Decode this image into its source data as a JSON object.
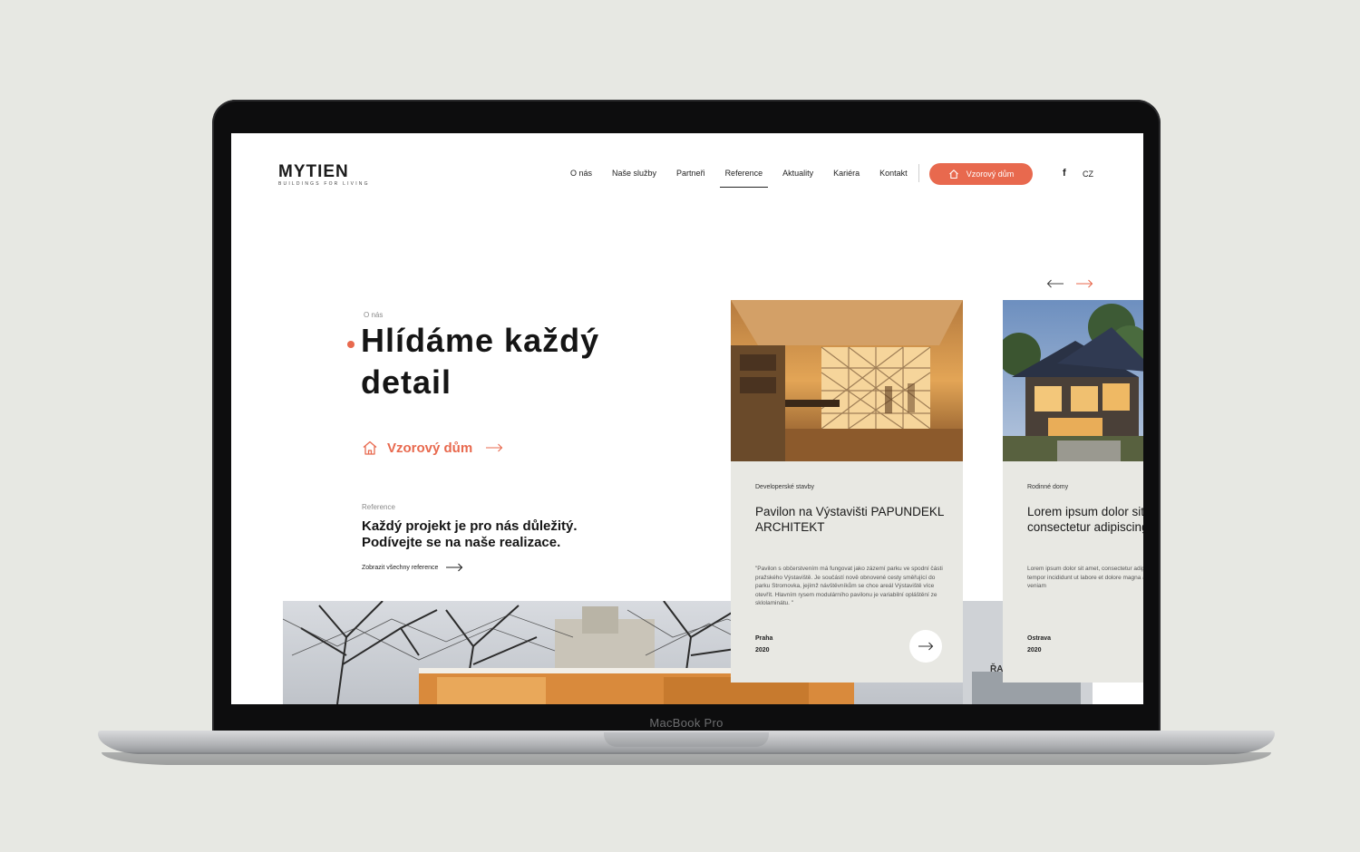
{
  "device": {
    "label": "MacBook Pro"
  },
  "header": {
    "logo": "MYTIEN",
    "tagline": "BUILDINGS FOR LIVING",
    "nav": [
      {
        "label": "O nás"
      },
      {
        "label": "Naše služby"
      },
      {
        "label": "Partneři"
      },
      {
        "label": "Reference"
      },
      {
        "label": "Aktuality"
      },
      {
        "label": "Kariéra"
      },
      {
        "label": "Kontakt"
      }
    ],
    "active_nav": "Reference",
    "cta_label": "Vzorový dům",
    "social_icon": "facebook-icon",
    "language": "CZ"
  },
  "hero": {
    "eyebrow": "O nás",
    "title": "Hlídáme každý detail",
    "link_label": "Vzorový dům"
  },
  "reference": {
    "eyebrow": "Reference",
    "heading": "Každý projekt je pro nás důležitý. Podívejte se na naše realizace.",
    "link_label": "Zobrazit všechny reference"
  },
  "cards": [
    {
      "category": "Developerské stavby",
      "title": "Pavilon na Výstavišti PAPUNDEKL ARCHITEKT",
      "description": "\"Pavilon s občerstvením má fungovat jako zázemí parku ve spodní části pražského Výstaviště. Je součástí nově obnovené cesty směřující do parku Stromovka, jejímž návštěvníkům se chce areál Výstaviště více otevřít. Hlavním rysem modulárního pavilonu je variabilní opláštění ze sklolaminátu. \"",
      "city": "Praha",
      "year": "2020"
    },
    {
      "category": "Rodinné domy",
      "title": "Lorem ipsum dolor sit amet, consectetur adipiscing elit",
      "description": "Lorem ipsum dolor sit amet, consectetur adipiscing elit, sed do eiusmod tempor incididunt ut labore et dolore magna aliqua. Ut enim ad minim veniam",
      "city": "Ostrava",
      "year": "2020"
    }
  ],
  "colors": {
    "accent": "#e8694e",
    "card_bg": "#e8e8e3",
    "text": "#151515",
    "backdrop": "#e7e8e3"
  }
}
